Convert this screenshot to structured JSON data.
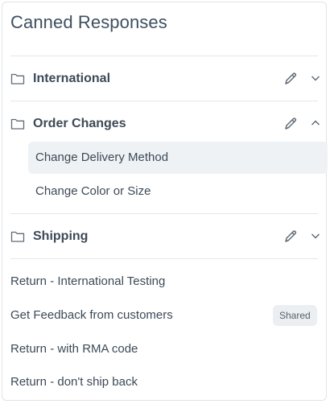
{
  "panel": {
    "title": "Canned Responses"
  },
  "folders": [
    {
      "label": "International",
      "icon": "folder-icon",
      "expanded": false
    },
    {
      "label": "Order Changes",
      "icon": "folder-icon",
      "expanded": true,
      "items": [
        {
          "label": "Change Delivery Method",
          "active": true
        },
        {
          "label": "Change Color or Size",
          "active": false
        }
      ]
    },
    {
      "label": "Shipping",
      "icon": "folder-icon",
      "expanded": false
    }
  ],
  "responses": [
    {
      "label": "Return - International Testing"
    },
    {
      "label": "Get Feedback from customers",
      "badge": "Shared"
    },
    {
      "label": "Return - with RMA code"
    },
    {
      "label": "Return - don't ship back"
    }
  ],
  "colors": {
    "active_bg": "#eff2f5",
    "badge_bg": "#eceff2",
    "text": "#3c4a57",
    "title": "#3d4f5f"
  }
}
